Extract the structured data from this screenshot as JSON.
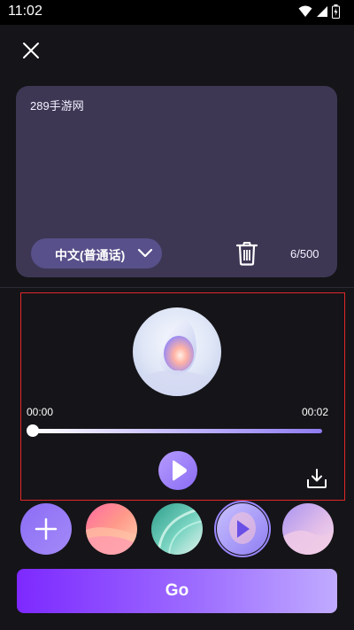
{
  "status_bar": {
    "time": "11:02",
    "icons": [
      "wifi-icon",
      "signal-icon",
      "battery-icon"
    ]
  },
  "toolbar": {
    "close_icon": "close-icon"
  },
  "text_card": {
    "content": "289手游网",
    "language": "中文(普通话)",
    "char_count": "6/500",
    "delete_icon": "trash-icon"
  },
  "player": {
    "time_current": "00:00",
    "time_total": "00:02",
    "progress": 0,
    "play_icon": "play-icon",
    "download_icon": "download-icon"
  },
  "voices": {
    "add_icon": "plus-icon",
    "selected_index": 3
  },
  "actions": {
    "go_label": "Go"
  },
  "colors": {
    "background": "#151418",
    "card": "#3d3754",
    "accent": "#8a6cf3",
    "highlight_border": "#e0282a"
  }
}
